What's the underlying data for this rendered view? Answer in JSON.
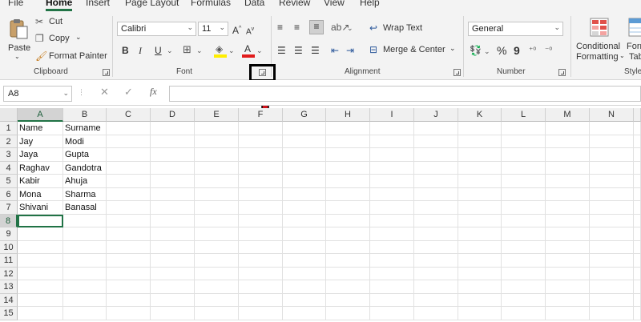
{
  "menu": {
    "tabs": [
      {
        "label": "File"
      },
      {
        "label": "Home",
        "active": true
      },
      {
        "label": "Insert"
      },
      {
        "label": "Page Layout"
      },
      {
        "label": "Formulas"
      },
      {
        "label": "Data"
      },
      {
        "label": "Review"
      },
      {
        "label": "View"
      },
      {
        "label": "Help"
      }
    ]
  },
  "ribbon": {
    "clipboard": {
      "paste": "Paste",
      "cut": "Cut",
      "copy": "Copy",
      "format_painter": "Format Painter",
      "group_label": "Clipboard"
    },
    "font": {
      "font_name": "Calibri",
      "font_size": "11",
      "bold": "B",
      "italic": "I",
      "underline": "U",
      "font_color_letter": "A",
      "group_label": "Font"
    },
    "alignment": {
      "wrap_text": "Wrap Text",
      "merge_center": "Merge & Center",
      "group_label": "Alignment"
    },
    "number": {
      "format": "General",
      "percent": "%",
      "comma": "9",
      "group_label": "Number"
    },
    "styles": {
      "conditional_formatting_line1": "Conditional",
      "conditional_formatting_line2": "Formatting",
      "format_as_table_line1": "Form",
      "format_as_table_line2": "Tab",
      "group_label": "Styles"
    }
  },
  "formula_bar": {
    "name_box": "A8",
    "fx": "fx",
    "formula": ""
  },
  "grid": {
    "columns": [
      "A",
      "B",
      "C",
      "D",
      "E",
      "F",
      "G",
      "H",
      "I",
      "J",
      "K",
      "L",
      "M",
      "N"
    ],
    "active_column": "A",
    "rows": [
      "1",
      "2",
      "3",
      "4",
      "5",
      "6",
      "7",
      "8",
      "9",
      "10",
      "11",
      "12",
      "13",
      "14",
      "15"
    ],
    "active_row": "8",
    "cells": [
      [
        "Name",
        "Surname"
      ],
      [
        "Jay",
        "Modi"
      ],
      [
        "Jaya",
        "Gupta"
      ],
      [
        "Raghav",
        "Gandotra"
      ],
      [
        "Kabir",
        "Ahuja"
      ],
      [
        "Mona",
        "Sharma"
      ],
      [
        "Shivani",
        "Banasal"
      ]
    ]
  },
  "colors": {
    "accent": "#217346",
    "annotation_arrow": "#d0121b",
    "font_color_bar": "#e11b1b",
    "highlight_bar": "#ffee00"
  }
}
